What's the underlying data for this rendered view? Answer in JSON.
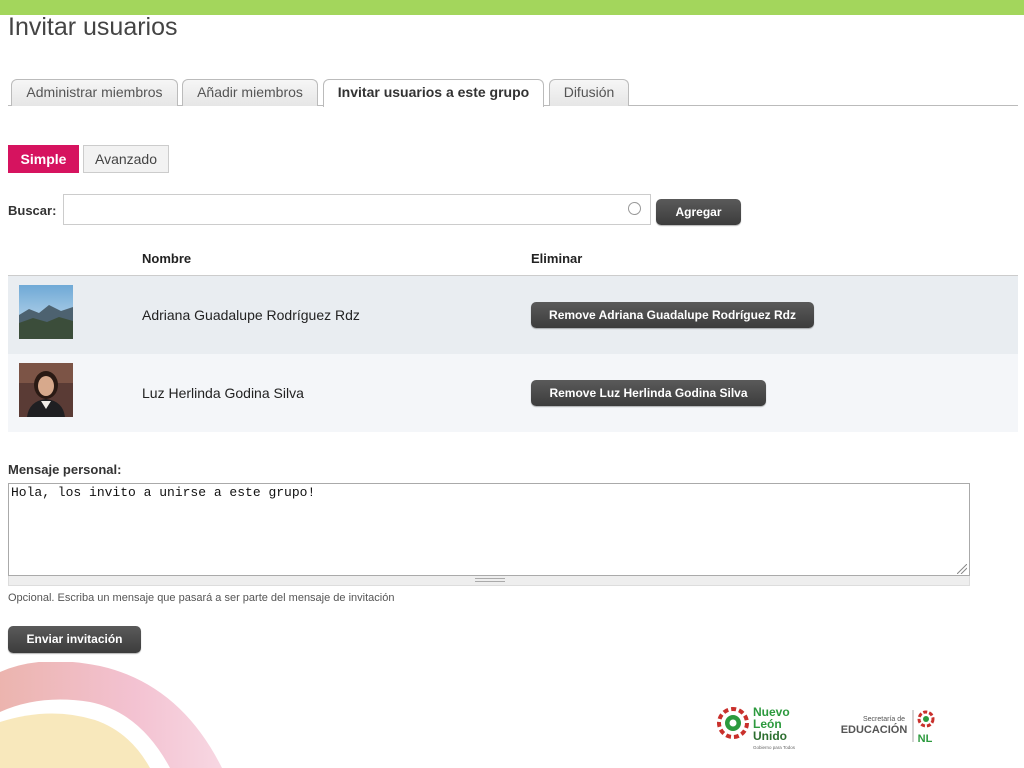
{
  "page": {
    "title": "Invitar usuarios"
  },
  "tabs": [
    {
      "label": "Administrar miembros",
      "active": false
    },
    {
      "label": "Añadir miembros",
      "active": false
    },
    {
      "label": "Invitar usuarios a este grupo",
      "active": true
    },
    {
      "label": "Difusión",
      "active": false
    }
  ],
  "mode": {
    "simple_label": "Simple",
    "advanced_label": "Avanzado",
    "selected": "Simple",
    "accent_color": "#d6135f"
  },
  "search": {
    "label": "Buscar:",
    "value": "",
    "placeholder": "",
    "add_button": "Agregar"
  },
  "table": {
    "headers": [
      "Nombre",
      "Eliminar"
    ],
    "rows": [
      {
        "name": "Adriana Guadalupe Rodríguez Rdz",
        "remove_label": "Remove Adriana Guadalupe Rodríguez Rdz",
        "avatar": "landscape-photo"
      },
      {
        "name": "Luz Herlinda Godina Silva",
        "remove_label": "Remove Luz Herlinda Godina Silva",
        "avatar": "person-photo"
      }
    ]
  },
  "message": {
    "label": "Mensaje personal:",
    "value": "Hola, los invito a unirse a este grupo!",
    "help": "Opcional. Escriba un mensaje que pasará a ser parte del mensaje de invitación"
  },
  "send_button": "Enviar invitación",
  "footer": {
    "logo1": {
      "line1": "Nuevo",
      "line2": "León",
      "line3": "Unido",
      "tagline": "Gobierno para Todos"
    },
    "logo2": {
      "line1": "Secretaría de",
      "line2": "EDUCACIÓN",
      "line3": "NL"
    }
  },
  "colors": {
    "top_bar": "#a3d65c",
    "accent": "#d6135f",
    "button_dark": "#444444"
  }
}
